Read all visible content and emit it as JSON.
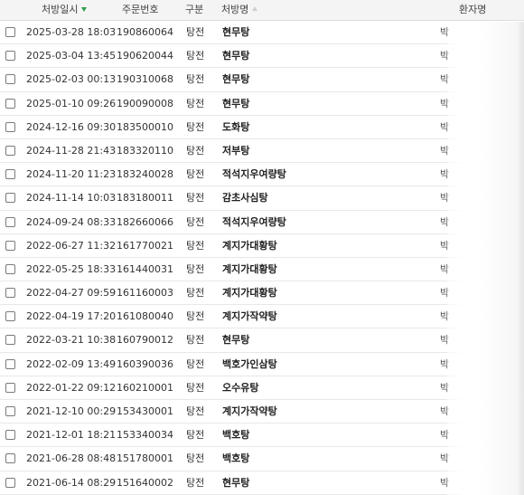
{
  "columns": {
    "date": "처방일시",
    "order_no": "주문번호",
    "type": "구분",
    "prescription": "처방명",
    "patient": "환자명"
  },
  "sort": {
    "column": "date",
    "direction": "desc"
  },
  "rows": [
    {
      "date": "2025-03-28 18:03",
      "order_no": "190860064",
      "type": "탕전",
      "prescription": "현무탕",
      "patient": "박"
    },
    {
      "date": "2025-03-04 13:45",
      "order_no": "190620044",
      "type": "탕전",
      "prescription": "현무탕",
      "patient": "박"
    },
    {
      "date": "2025-02-03 00:13",
      "order_no": "190310068",
      "type": "탕전",
      "prescription": "현무탕",
      "patient": "박"
    },
    {
      "date": "2025-01-10 09:26",
      "order_no": "190090008",
      "type": "탕전",
      "prescription": "현무탕",
      "patient": "박"
    },
    {
      "date": "2024-12-16 09:30",
      "order_no": "183500010",
      "type": "탕전",
      "prescription": "도화탕",
      "patient": "박"
    },
    {
      "date": "2024-11-28 21:43",
      "order_no": "183320110",
      "type": "탕전",
      "prescription": "저부탕",
      "patient": "박"
    },
    {
      "date": "2024-11-20 11:23",
      "order_no": "183240028",
      "type": "탕전",
      "prescription": "적석지우여량탕",
      "patient": "박"
    },
    {
      "date": "2024-11-14 10:03",
      "order_no": "183180011",
      "type": "탕전",
      "prescription": "감초사심탕",
      "patient": "박"
    },
    {
      "date": "2024-09-24 08:33",
      "order_no": "182660066",
      "type": "탕전",
      "prescription": "적석지우여량탕",
      "patient": "박"
    },
    {
      "date": "2022-06-27 11:32",
      "order_no": "161770021",
      "type": "탕전",
      "prescription": "계지가대황탕",
      "patient": "박"
    },
    {
      "date": "2022-05-25 18:33",
      "order_no": "161440031",
      "type": "탕전",
      "prescription": "계지가대황탕",
      "patient": "박"
    },
    {
      "date": "2022-04-27 09:59",
      "order_no": "161160003",
      "type": "탕전",
      "prescription": "계지가대황탕",
      "patient": "박"
    },
    {
      "date": "2022-04-19 17:20",
      "order_no": "161080040",
      "type": "탕전",
      "prescription": "계지가작약탕",
      "patient": "박"
    },
    {
      "date": "2022-03-21 10:38",
      "order_no": "160790012",
      "type": "탕전",
      "prescription": "현무탕",
      "patient": "박"
    },
    {
      "date": "2022-02-09 13:49",
      "order_no": "160390036",
      "type": "탕전",
      "prescription": "백호가인삼탕",
      "patient": "박"
    },
    {
      "date": "2022-01-22 09:12",
      "order_no": "160210001",
      "type": "탕전",
      "prescription": "오수유탕",
      "patient": "박"
    },
    {
      "date": "2021-12-10 00:29",
      "order_no": "153430001",
      "type": "탕전",
      "prescription": "계지가작약탕",
      "patient": "박"
    },
    {
      "date": "2021-12-01 18:21",
      "order_no": "153340034",
      "type": "탕전",
      "prescription": "백호탕",
      "patient": "박"
    },
    {
      "date": "2021-06-28 08:48",
      "order_no": "151780001",
      "type": "탕전",
      "prescription": "백호탕",
      "patient": "박"
    },
    {
      "date": "2021-06-14 08:29",
      "order_no": "151640002",
      "type": "탕전",
      "prescription": "현무탕",
      "patient": "박"
    }
  ]
}
